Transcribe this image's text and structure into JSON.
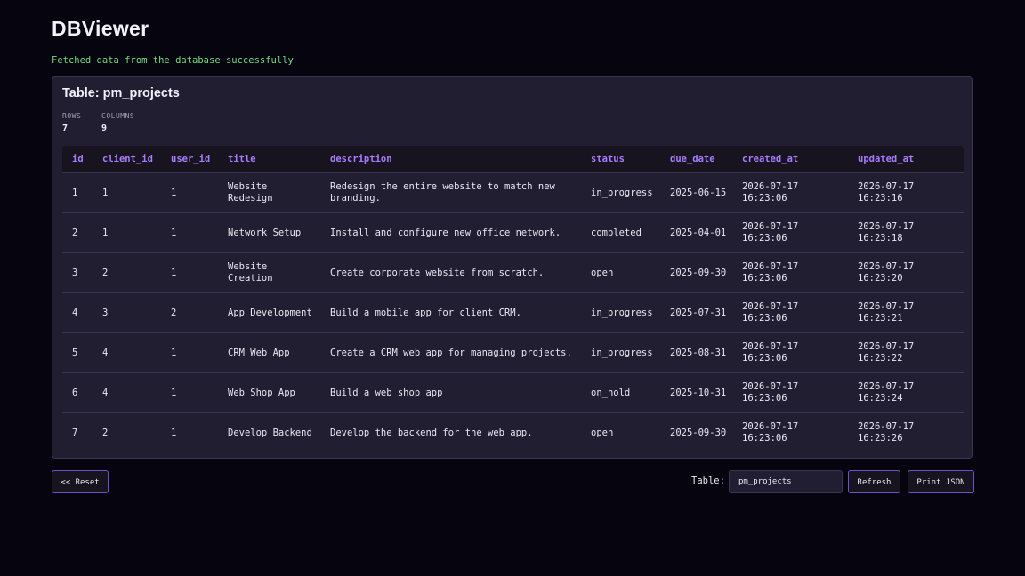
{
  "app": {
    "title": "DBViewer",
    "status_message": "Fetched data from the database successfully"
  },
  "panel": {
    "title": "Table: pm_projects",
    "stats": [
      {
        "label": "ROWS",
        "value": "7"
      },
      {
        "label": "COLUMNS",
        "value": "9"
      }
    ]
  },
  "table": {
    "columns": [
      "id",
      "client_id",
      "user_id",
      "title",
      "description",
      "status",
      "due_date",
      "created_at",
      "updated_at"
    ],
    "rows": [
      [
        "1",
        "1",
        "1",
        "Website Redesign",
        "Redesign the entire website to match new branding.",
        "in_progress",
        "2025-06-15",
        "2026-07-17 16:23:06",
        "2026-07-17 16:23:16"
      ],
      [
        "2",
        "1",
        "1",
        "Network Setup",
        "Install and configure new office network.",
        "completed",
        "2025-04-01",
        "2026-07-17 16:23:06",
        "2026-07-17 16:23:18"
      ],
      [
        "3",
        "2",
        "1",
        "Website Creation",
        "Create corporate website from scratch.",
        "open",
        "2025-09-30",
        "2026-07-17 16:23:06",
        "2026-07-17 16:23:20"
      ],
      [
        "4",
        "3",
        "2",
        "App Development",
        "Build a mobile app for client CRM.",
        "in_progress",
        "2025-07-31",
        "2026-07-17 16:23:06",
        "2026-07-17 16:23:21"
      ],
      [
        "5",
        "4",
        "1",
        "CRM Web App",
        "Create a CRM web app for managing projects.",
        "in_progress",
        "2025-08-31",
        "2026-07-17 16:23:06",
        "2026-07-17 16:23:22"
      ],
      [
        "6",
        "4",
        "1",
        "Web Shop App",
        "Build a web shop app",
        "on_hold",
        "2025-10-31",
        "2026-07-17 16:23:06",
        "2026-07-17 16:23:24"
      ],
      [
        "7",
        "2",
        "1",
        "Develop Backend",
        "Develop the backend for the web app.",
        "open",
        "2025-09-30",
        "2026-07-17 16:23:06",
        "2026-07-17 16:23:26"
      ]
    ]
  },
  "controls": {
    "reset_label": "<< Reset",
    "table_label": "Table:",
    "table_input_value": "pm_projects",
    "refresh_label": "Refresh",
    "print_label": "Print JSON"
  },
  "colors": {
    "background": "#05040f",
    "panel": "#221e32",
    "accent": "#a97cff",
    "success": "#74dc80",
    "button_border": "#6c54c8"
  }
}
